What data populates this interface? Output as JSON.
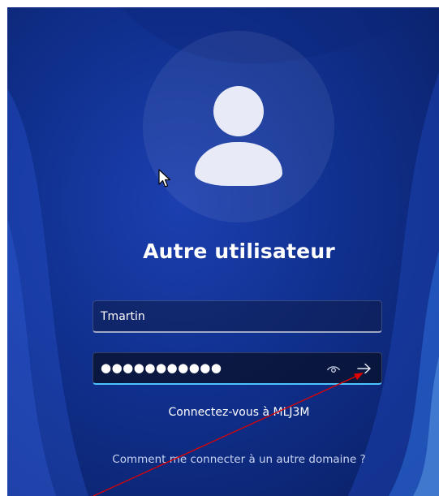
{
  "login": {
    "title": "Autre utilisateur",
    "username_value": "Tmartin",
    "password_mask": "●●●●●●●●●●●",
    "connect_to_text": "Connectez-vous à MLJ3M",
    "other_domain_link": "Comment me connecter à un autre domaine ?"
  },
  "icons": {
    "avatar": "user-avatar-icon",
    "reveal_password": "eye-icon",
    "submit": "arrow-right-icon",
    "pointer": "mouse-cursor-icon"
  },
  "colors": {
    "background": "#10308e",
    "focus_accent": "#4cc2ff",
    "avatar_fill": "#e8ebf7",
    "annotation_arrow": "#e00000"
  }
}
